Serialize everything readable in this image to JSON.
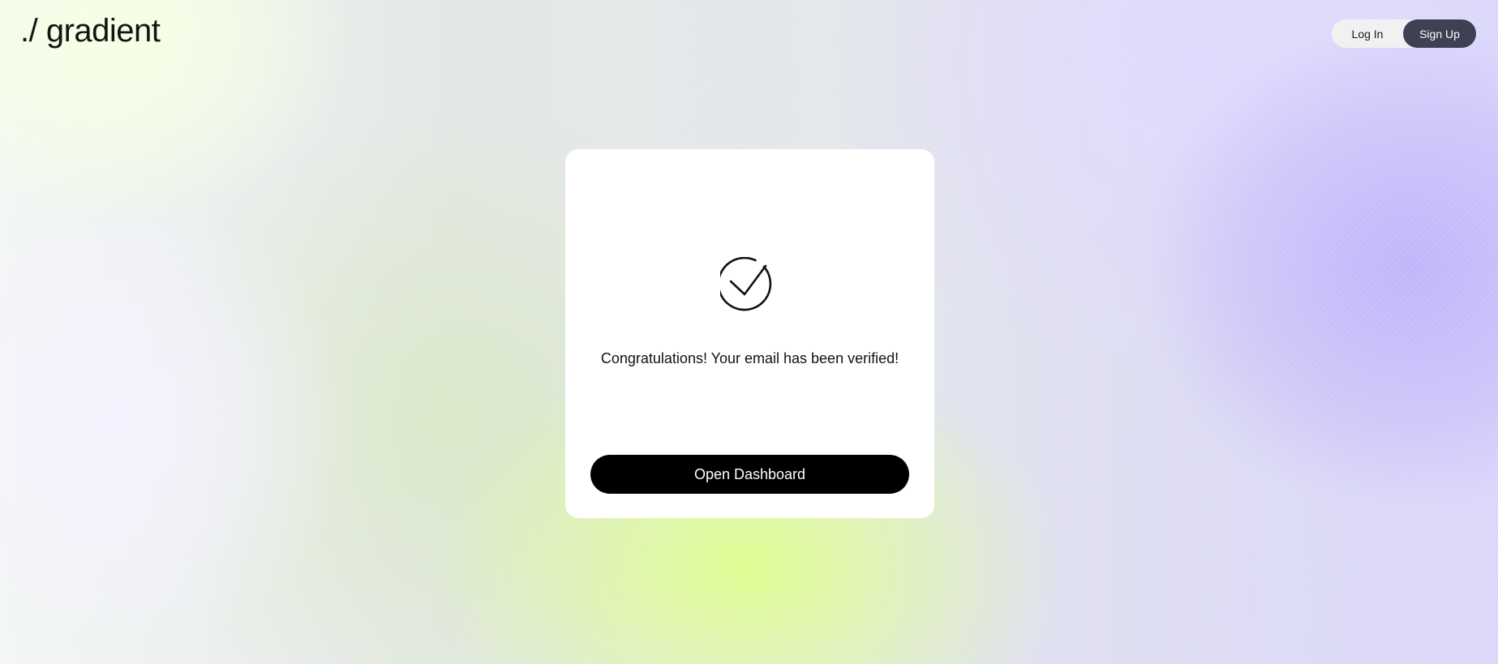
{
  "header": {
    "logo_text": "./ gradient",
    "login_label": "Log In",
    "signup_label": "Sign Up"
  },
  "card": {
    "icon": "check-circle-icon",
    "message": "Congratulations! Your email has been verified!",
    "button_label": "Open Dashboard"
  },
  "colors": {
    "signup_bg": "#3e4053",
    "button_bg": "#000000",
    "card_bg": "#ffffff",
    "accent_green": "#deff8c",
    "accent_violet": "#beb4fa"
  }
}
